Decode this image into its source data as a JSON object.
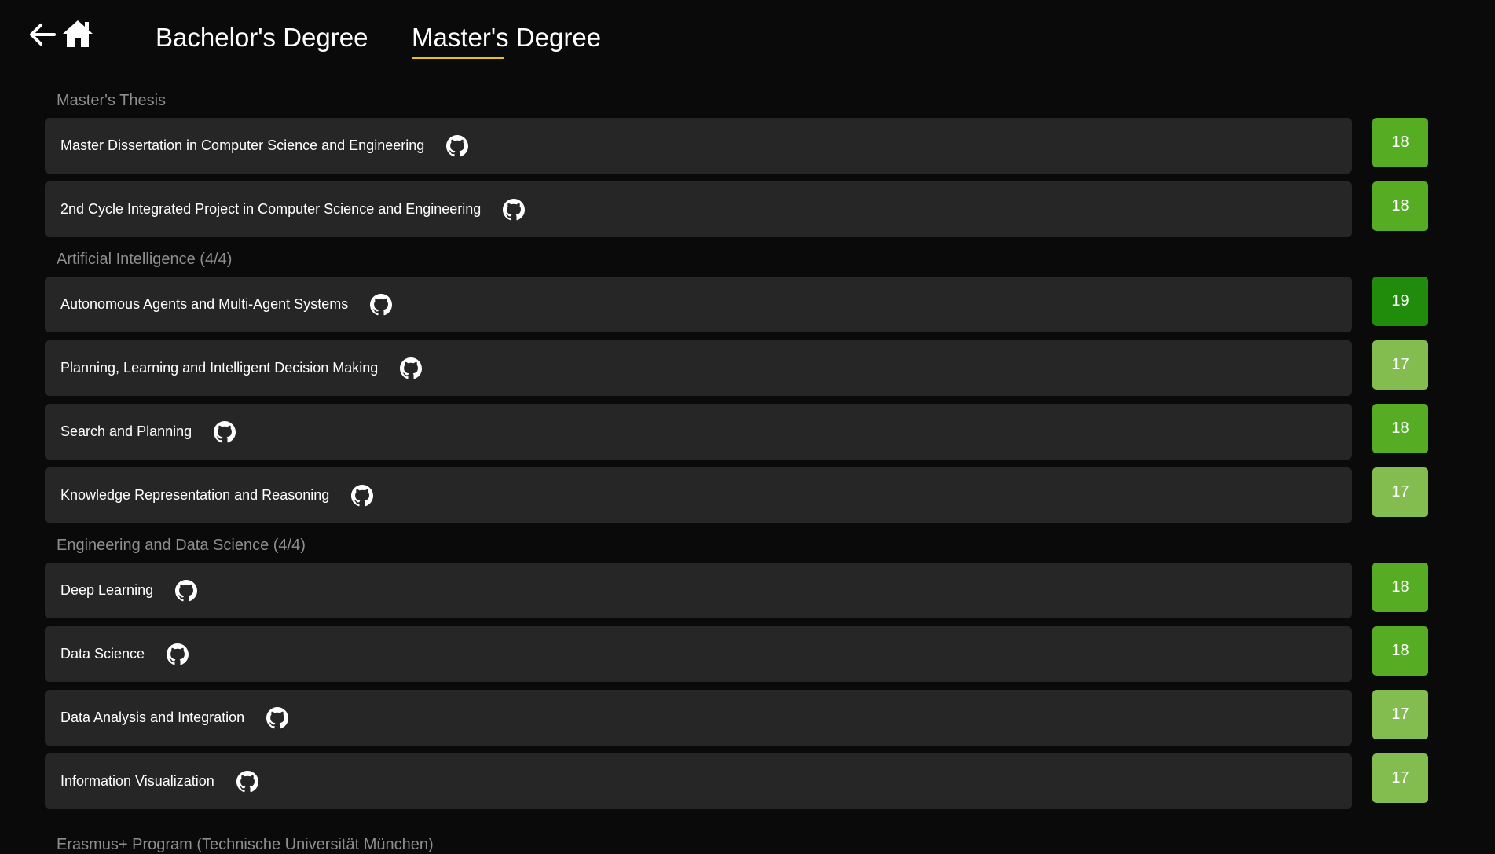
{
  "nav": {
    "back_icon": "arrow-left-icon",
    "home_icon": "home-icon",
    "tabs": [
      {
        "label": "Bachelor's Degree",
        "active": false
      },
      {
        "label": "Master's Degree",
        "active": true
      }
    ],
    "active_underline_color": "#e8c20c"
  },
  "sections": [
    {
      "title": "Master's Thesis",
      "courses": [
        {
          "name": "Master Dissertation in Computer Science and Engineering",
          "grade": "18",
          "icon": "github-icon"
        },
        {
          "name": "2nd Cycle Integrated Project in Computer Science and Engineering",
          "grade": "18",
          "icon": "github-icon"
        }
      ]
    },
    {
      "title": "Artificial Intelligence (4/4)",
      "courses": [
        {
          "name": "Autonomous Agents and Multi-Agent Systems",
          "grade": "19",
          "icon": "github-icon"
        },
        {
          "name": "Planning, Learning and Intelligent Decision Making",
          "grade": "17",
          "icon": "github-icon"
        },
        {
          "name": "Search and Planning",
          "grade": "18",
          "icon": "github-icon"
        },
        {
          "name": "Knowledge Representation and Reasoning",
          "grade": "17",
          "icon": "github-icon"
        }
      ]
    },
    {
      "title": "Engineering and Data Science (4/4)",
      "courses": [
        {
          "name": "Deep Learning",
          "grade": "18",
          "icon": "github-icon"
        },
        {
          "name": "Data Science",
          "grade": "18",
          "icon": "github-icon"
        },
        {
          "name": "Data Analysis and Integration",
          "grade": "17",
          "icon": "github-icon"
        },
        {
          "name": "Information Visualization",
          "grade": "17",
          "icon": "github-icon"
        }
      ]
    }
  ],
  "next_section_title": "Erasmus+ Program (Technische Universität München)",
  "grade_colors": {
    "19": "#218c0b",
    "18": "#56ad24",
    "17": "#83bd4f"
  },
  "colors": {
    "background": "#0a0a0a",
    "card": "#262626",
    "section_title": "#8e8e8e"
  }
}
